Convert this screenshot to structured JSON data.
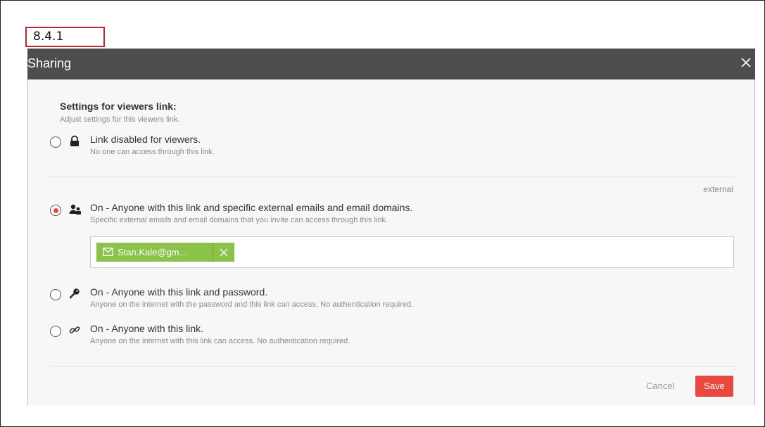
{
  "label_box": "8.4.1",
  "modal": {
    "title": "Sharing",
    "close_icon": "close-icon"
  },
  "section": {
    "title": "Settings for viewers link:",
    "subtitle": "Adjust settings for this viewers link."
  },
  "options": [
    {
      "icon": "lock-icon",
      "title": "Link disabled for viewers.",
      "description": "No one can access through this link.",
      "selected": false
    },
    {
      "icon": "users-icon",
      "title": "On - Anyone with this link and specific external emails and email domains.",
      "description": "Specific external emails and email domains that you invite can access through this link.",
      "selected": true
    },
    {
      "icon": "key-icon",
      "title": "On - Anyone with this link and password.",
      "description": "Anyone on the internet with the password and this link can access. No authentication required.",
      "selected": false
    },
    {
      "icon": "link-icon",
      "title": "On - Anyone with this link.",
      "description": "Anyone on the internet with this link can access. No authentication required.",
      "selected": false
    }
  ],
  "external_label": "external",
  "email_tags": [
    {
      "text": "Stan.Kale@gm…",
      "icon": "mail-icon"
    }
  ],
  "footer": {
    "cancel_label": "Cancel",
    "save_label": "Save"
  },
  "colors": {
    "header_bg": "#4d4d4d",
    "accent_red": "#e8483f",
    "tag_green": "#8bc34a",
    "label_border": "#c0262d"
  }
}
